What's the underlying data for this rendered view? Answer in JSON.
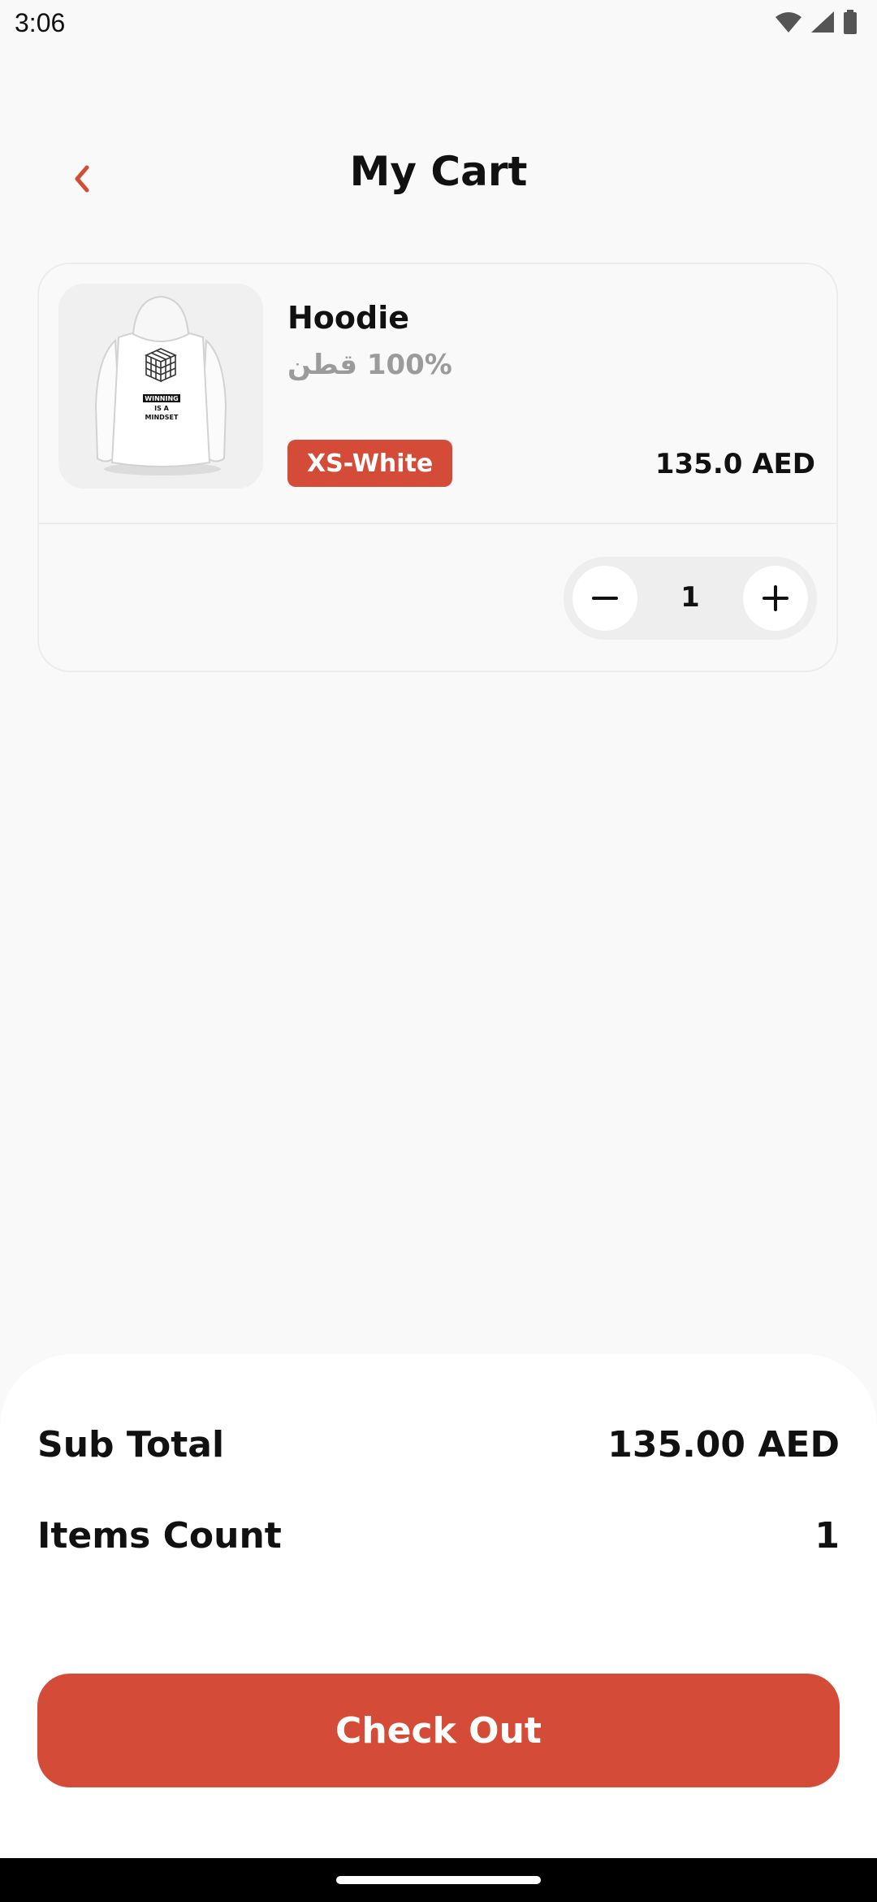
{
  "status_bar": {
    "time": "3:06",
    "icons": [
      "wifi-icon",
      "signal-icon",
      "battery-icon"
    ]
  },
  "header": {
    "title": "My Cart",
    "back_icon": "chevron-left-icon"
  },
  "cart": {
    "items": [
      {
        "name": "Hoodie",
        "material": "100% قطن",
        "variant": "XS-White",
        "price": "135.0 AED",
        "quantity": "1",
        "image_text": [
          "WINNING",
          "IS A",
          "MINDSET"
        ]
      }
    ]
  },
  "summary": {
    "subtotal_label": "Sub Total",
    "subtotal_value": "135.00 AED",
    "count_label": "Items Count",
    "count_value": "1",
    "checkout_label": "Check Out"
  },
  "colors": {
    "accent": "#d44c37",
    "background": "#f9f9f9",
    "muted_text": "#9b9b9b"
  }
}
